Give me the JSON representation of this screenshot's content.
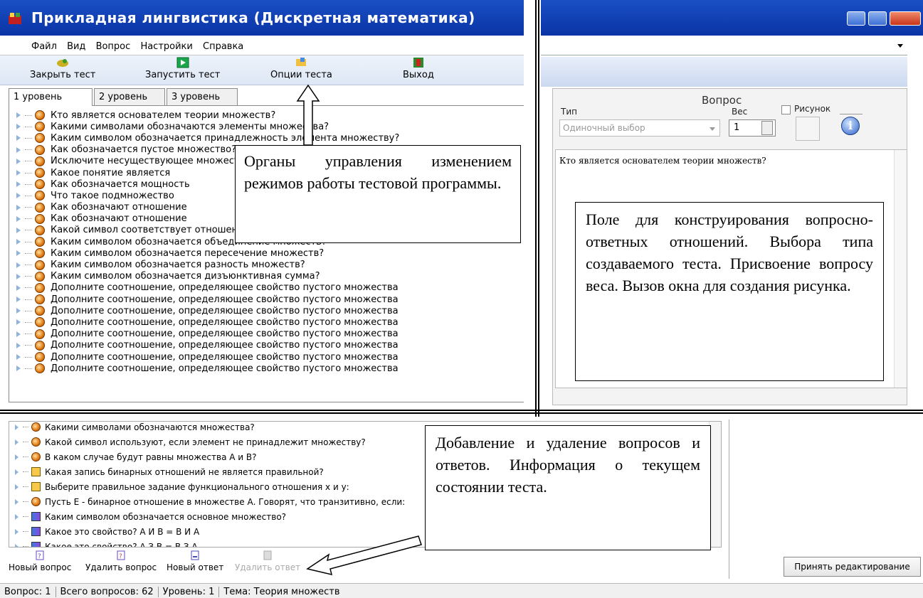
{
  "title": "Прикладная лингвистика (Дискретная математика)",
  "menu": [
    "Файл",
    "Вид",
    "Вопрос",
    "Настройки",
    "Справка"
  ],
  "toolbar": {
    "close_test": "Закрыть тест",
    "run_test": "Запустить тест",
    "options": "Опции теста",
    "exit": "Выход"
  },
  "tabs": [
    "1 уровень",
    "2 уровень",
    "3 уровень"
  ],
  "questions": [
    "Кто является основателем теории множеств?",
    "Какими символами обозначаются элементы множества?",
    "Каким символом обозначается принадлежность элемента множеству?",
    "Как обозначается пустое множество?",
    "Исключите несуществующее множество",
    "Какое понятие является",
    "Как обозначается мощность",
    "Что такое подмножество",
    "Как обозначают отношение",
    "Как обозначают отношение",
    "Какой символ соответствует отношению исключения?",
    "Каким символом обозначается объединение множеств?",
    "Каким символом обозначается пересечение множеств?",
    "Каким символом обозначается разность множеств?",
    "Каким символом обозначается дизъюнктивная сумма?",
    "Дополните соотношение, определяющее свойство пустого множества",
    "Дополните соотношение, определяющее свойство пустого множества",
    "Дополните соотношение, определяющее свойство пустого множества",
    "Дополните соотношение, определяющее свойство пустого множества",
    "Дополните соотношение, определяющее свойство пустого множества",
    "Дополните соотношение, определяющее свойство пустого множества",
    "Дополните соотношение, определяющее свойство пустого множества",
    "Дополните соотношение, определяющее свойство пустого множества"
  ],
  "editor": {
    "header": "Вопрос",
    "type_label": "Тип",
    "type_value": "Одиночный выбор",
    "weight_label": "Вес",
    "weight_value": "1",
    "picture_label": "Рисунок",
    "question_text": "Кто является основателем теории множеств?"
  },
  "bottom_list": [
    {
      "icon": "ring",
      "text": "Какими символами обозначаются множества?"
    },
    {
      "icon": "ring",
      "text": "Какой символ используют, если элемент не принадлежит множеству?"
    },
    {
      "icon": "ring",
      "text": "В каком случае будут равны множества А и В?"
    },
    {
      "icon": "check",
      "text": "Какая запись бинарных отношений не является правильной?"
    },
    {
      "icon": "check",
      "text": "Выберите правильное задание функционального отношения х и у:"
    },
    {
      "icon": "ring",
      "text": "Пусть Е - бинарное отношение в множестве А. Говорят, что транзитивно, если:"
    },
    {
      "icon": "flag",
      "text": "Каким символом обозначается основное множество?"
    },
    {
      "icon": "flag",
      "text": "Какое это свойство? А И В = В И А"
    },
    {
      "icon": "flag",
      "text": "Какое это свойство? А З В = В З А"
    }
  ],
  "bottom_toolbar": {
    "new_question": "Новый вопрос",
    "delete_question": "Удалить вопрос",
    "new_answer": "Новый ответ",
    "delete_answer": "Удалить ответ"
  },
  "accept_button": "Принять редактирование",
  "status": {
    "question": "Вопрос: 1",
    "total": "Всего вопросов: 62",
    "level": "Уровень: 1",
    "topic": "Тема: Теория множеств"
  },
  "callouts": {
    "controls": "Органы управления изменением режимов работы тестовой программы.",
    "field": "Поле для конструирования вопросно-ответных отношений. Выбора типа создаваемого теста. Присвоение вопросу веса. Вызов окна для создания рисунка.",
    "add_remove": "Добавление и удаление вопросов и ответов. Информация о текущем состоянии теста."
  },
  "colors": {
    "titlebar": "#0a34a6",
    "toolbar_bg": "#dde7f5",
    "question_icon": "#e07810"
  }
}
